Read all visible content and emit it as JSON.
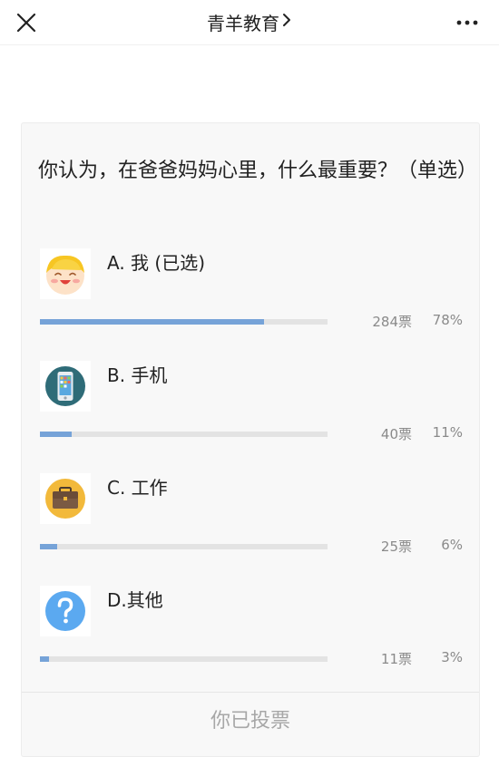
{
  "header": {
    "title": "青羊教育",
    "close_icon": "close-icon",
    "more_icon": "more-dots-icon"
  },
  "poll": {
    "question": "你认为，在爸爸妈妈心里，什么最重要？（单选）",
    "options": [
      {
        "label": "A. 我 (已选)",
        "votes": "284票",
        "percent": "78%",
        "fraction": 0.78,
        "icon": "smiley-face-icon"
      },
      {
        "label": "B. 手机",
        "votes": "40票",
        "percent": "11%",
        "fraction": 0.11,
        "icon": "phone-icon"
      },
      {
        "label": "C. 工作",
        "votes": "25票",
        "percent": "6%",
        "fraction": 0.06,
        "icon": "briefcase-icon"
      },
      {
        "label": "D.其他",
        "votes": "11票",
        "percent": "3%",
        "fraction": 0.03,
        "icon": "question-mark-icon"
      }
    ],
    "footer_text": "你已投票"
  },
  "colors": {
    "bar_fill": "#76a3d8",
    "bar_track": "#e3e3e3",
    "card_bg": "#f8f8f8"
  }
}
